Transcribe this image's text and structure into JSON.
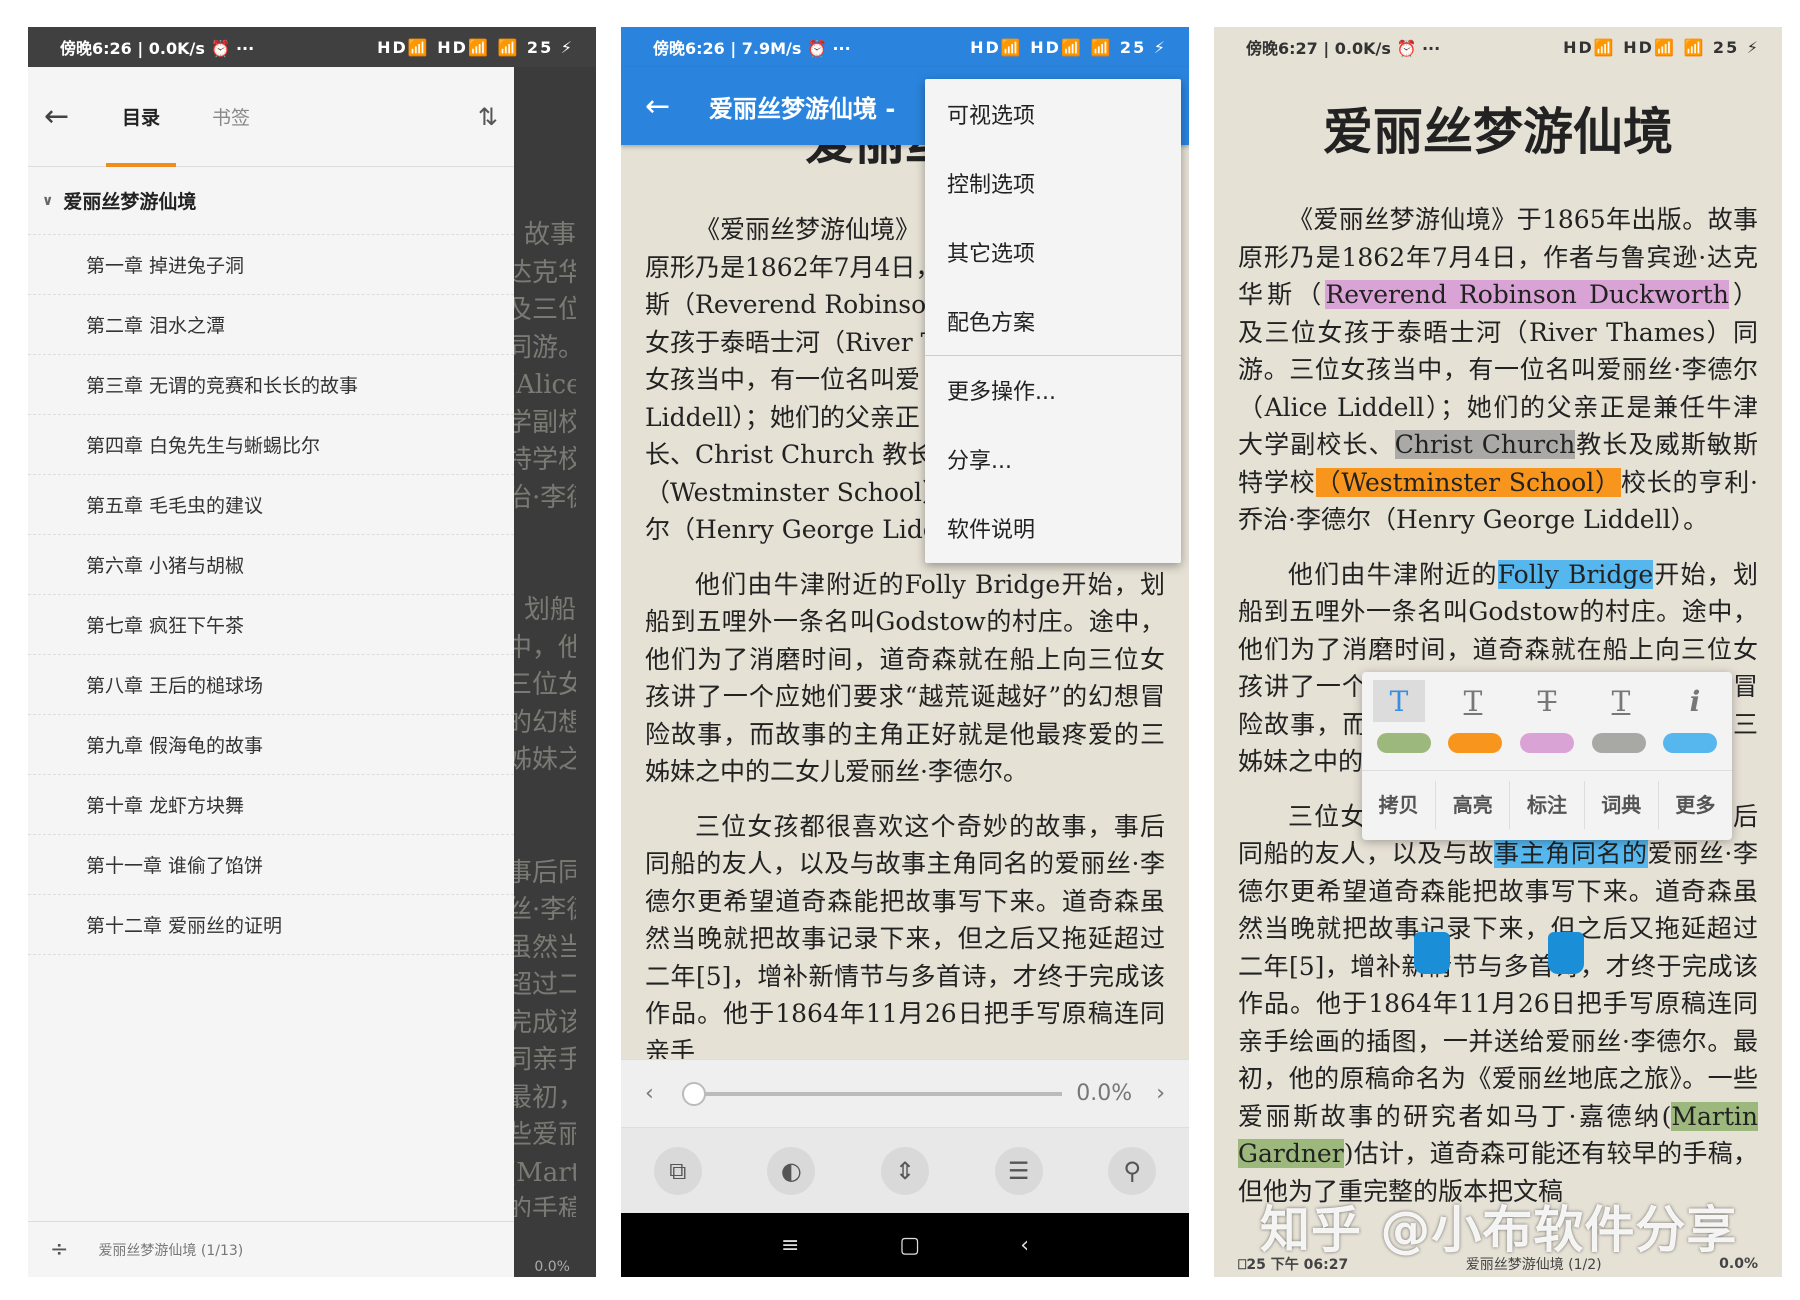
{
  "phone1": {
    "status": {
      "time": "傍晚6:26 | 0.0K/s ⏰ ···",
      "icons": "HD📶 HD📶 📶 25 ⚡"
    },
    "drawer": {
      "back_icon": "←",
      "tabs": [
        "目录",
        "书签"
      ],
      "sort_icon": "⇅",
      "root_title": "爱丽丝梦游仙境",
      "chapters": [
        "第一章 掉进兔子洞",
        "第二章 泪水之潭",
        "第三章 无谓的竞赛和长长的故事",
        "第四章 白兔先生与蜥蜴比尔",
        "第五章 毛毛虫的建议",
        "第六章 小猪与胡椒",
        "第七章 疯狂下午茶",
        "第八章 王后的槌球场",
        "第九章 假海龟的故事",
        "第十章 龙虾方块舞",
        "第十一章 谁偷了馅饼",
        "第十二章 爱丽丝的证明"
      ],
      "footer_label": "爱丽丝梦游仙境 (1/13)"
    },
    "bg_text": [
      "故事",
      "达克华",
      "及三位",
      "同游。三位",
      "(Alice",
      "学副校",
      "特学校",
      "治·李德",
      "",
      "",
      "划船",
      "中，他",
      "三位女孩讲",
      "的幻想冒险故",
      "姊妹之",
      "",
      "",
      "事后同",
      "丝·李德",
      "虽然当",
      "超过二年",
      "完成该作",
      "同亲手",
      "最初，",
      "些爱丽",
      "(Martin",
      "的手稿，"
    ],
    "bg_pct": "0.0%"
  },
  "phone2": {
    "status": {
      "time": "傍晚6:26 | 7.9M/s ⏰ ···",
      "icons": "HD📶 HD📶 📶 25 ⚡"
    },
    "toolbar_title": "爱丽丝梦游仙境 -",
    "heading_fragment": "爱丽丝梦",
    "menu": [
      "可视选项",
      "控制选项",
      "其它选项",
      "配色方案",
      "更多操作...",
      "分享...",
      "软件说明"
    ],
    "lines_p1": [
      "《爱丽丝梦游仙境》",
      "原形乃是1862年7月4日，",
      "斯（Reverend Robinson",
      "女孩于泰晤士河（River T",
      "女孩当中，有一位名叫爱",
      "Liddell）；她们的父亲正",
      "长、Christ Church 教长",
      "（Westminster School）",
      "尔（Henry George Lidde"
    ],
    "para2": "他们由牛津附近的Folly Bridge开始，划船到五哩外一条名叫Godstow的村庄。途中，他们为了消磨时间，道奇森就在船上向三位女孩讲了一个应她们要求“越荒诞越好”的幻想冒险故事，而故事的主角正好就是他最疼爱的三姊妹之中的二女儿爱丽丝·李德尔。",
    "para3": "三位女孩都很喜欢这个奇妙的故事，事后同船的友人，以及与故事主角同名的爱丽丝·李德尔更希望道奇森能把故事写下来。道奇森虽然当晚就把故事记录下来，但之后又拖延超过二年[5]，增补新情节与多首诗，才终于完成该作品。他于1864年11月26日把手写原稿连同亲手",
    "progress": {
      "prev": "‹",
      "next": "›",
      "percent": "0.0%",
      "value": 0
    },
    "bottom_icons": [
      "book-layout-icon",
      "color-scheme-icon",
      "auto-scroll-icon",
      "toc-list-icon",
      "search-icon"
    ],
    "bottom_glyphs": [
      "⧉",
      "◐",
      "⇕",
      "☰",
      "⚲"
    ],
    "nav": [
      "≡",
      "▢",
      "‹"
    ]
  },
  "phone3": {
    "status": {
      "time": "傍晚6:27 | 0.0K/s ⏰ ···",
      "icons": "HD📶 HD📶 📶 25 ⚡"
    },
    "title": "爱丽丝梦游仙境",
    "p1": {
      "a": "《爱丽丝梦游仙境》于1865年出版。故事原形乃是1862年7月4日，作者与鲁宾逊·达克华斯（",
      "h1": "Reverend Robinson Duckworth",
      "b": "）及三位女孩于泰晤士河（River Thames）同游。三位女孩当中，有一位名叫爱丽丝·李德尔（Alice Liddell）；她们的父亲正是兼任牛津大学副校长、",
      "h2": "Christ Church",
      "c": "教长及威斯敏斯特学校",
      "h3": "（Westminster School）",
      "d": "校长的亨利·乔治·李德尔（Henry George Liddell）。"
    },
    "p2": {
      "a": "他们由牛津附近的",
      "h1": "Folly Bridge",
      "b": "开始，划船到五哩外一条名叫Godstow的村庄。途中，他们为了消磨时间，道奇森就在船上向三位女孩讲了一个应她们要求“越荒诞越好”的幻想冒险故事，而故事的主角正好就是他最疼爱的三姊妹之中的二女儿爱丽丝·李德尔。"
    },
    "p3": {
      "a": "三位女孩都很喜欢这个奇妙的故事，事后同船的友人，以及与故",
      "h1": "事主角同名的",
      "b": "爱丽丝·李德尔更希望道奇森能把故事写下来。道奇森虽然当晚就把故事记录下来，但之后又拖延超过二年[5]，增补新情节与多首诗，才终于完成该作品。他于1864年11月26日把手写原稿连同亲手绘画的插图，一并送给爱丽丝·李德尔。最初，他的原稿命名为《爱丽丝地底之旅》。一些爱丽斯故事的研究者如马丁·嘉德纳(",
      "h2": "Martin Gardner",
      "c": ")估计，道奇森可能还有较早的手稿，但他为了重完整的版本把文稿"
    },
    "popup": {
      "styles": [
        "T",
        "T",
        "T",
        "T",
        "i"
      ],
      "style_names": [
        "highlight-style-icon",
        "underline-style-icon",
        "strikethrough-style-icon",
        "squiggle-style-icon",
        "info-icon"
      ],
      "colors": [
        "#9cb87c",
        "#f8951d",
        "#d9a3d6",
        "#a8a8a5",
        "#56b7ee"
      ],
      "actions": [
        "拷贝",
        "高亮",
        "标注",
        "词典",
        "更多"
      ]
    },
    "footer": {
      "battery": "25",
      "time": "下午 06:27",
      "book": "爱丽丝梦游仙境 (1/2)",
      "percent": "0.0%"
    }
  },
  "watermark": "知乎 @小布软件分享",
  "colors": {
    "accent_orange": "#f08c1b",
    "toolbar_blue": "#2a84de",
    "paper": "#e6e1d5"
  }
}
